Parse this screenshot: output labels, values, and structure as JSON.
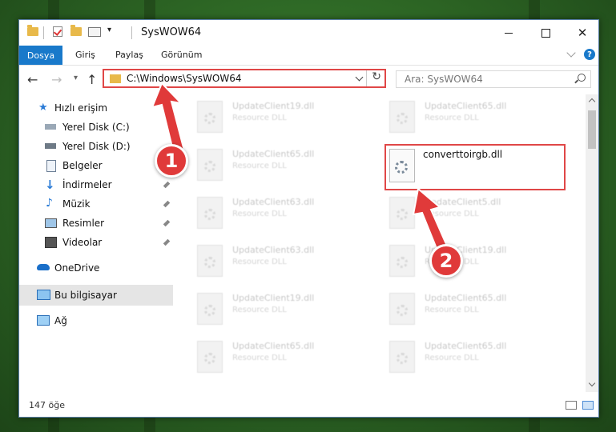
{
  "window": {
    "title": "SysWOW64"
  },
  "ribbon": {
    "tabs": [
      "Dosya",
      "Giriş",
      "Paylaş",
      "Görünüm"
    ],
    "help": "?"
  },
  "address": {
    "path": "C:\\Windows\\SysWOW64"
  },
  "search": {
    "placeholder": "Ara: SysWOW64"
  },
  "sidebar": {
    "items": [
      {
        "label": "Hızlı erişim",
        "icon": "star-icon"
      },
      {
        "label": "Yerel Disk (C:)",
        "icon": "drive-icon"
      },
      {
        "label": "Yerel Disk (D:)",
        "icon": "drive-icon"
      },
      {
        "label": "Belgeler",
        "icon": "documents-icon"
      },
      {
        "label": "İndirmeler",
        "icon": "download-icon"
      },
      {
        "label": "Müzik",
        "icon": "music-icon"
      },
      {
        "label": "Resimler",
        "icon": "pictures-icon"
      },
      {
        "label": "Videolar",
        "icon": "video-icon"
      },
      {
        "label": "OneDrive",
        "icon": "cloud-icon"
      },
      {
        "label": "Bu bilgisayar",
        "icon": "computer-icon"
      },
      {
        "label": "Ağ",
        "icon": "network-icon"
      }
    ]
  },
  "files": {
    "left": [
      {
        "name": "UpdateClient19.dll",
        "type": "Resource DLL"
      },
      {
        "name": "UpdateClient65.dll",
        "type": "Resource DLL"
      },
      {
        "name": "UpdateClient63.dll",
        "type": "Resource DLL"
      },
      {
        "name": "UpdateClient63.dll",
        "type": "Resource DLL"
      },
      {
        "name": "UpdateClient19.dll",
        "type": "Resource DLL"
      },
      {
        "name": "UpdateClient65.dll",
        "type": "Resource DLL"
      }
    ],
    "right": [
      {
        "name": "UpdateClient65.dll",
        "type": "Resource DLL"
      },
      {
        "name": "UpdateClient5.dll",
        "type": "Resource DLL"
      },
      {
        "name": "UpdateClient19.dll",
        "type": "Resource DLL"
      },
      {
        "name": "UpdateClient65.dll",
        "type": "Resource DLL"
      },
      {
        "name": "UpdateClient65.dll",
        "type": "Resource DLL"
      }
    ],
    "highlighted": {
      "name": "converttoirgb.dll"
    }
  },
  "status": {
    "count": "147 öğe"
  },
  "annotations": {
    "badge1": "1",
    "badge2": "2",
    "color": "#e03a3a"
  }
}
